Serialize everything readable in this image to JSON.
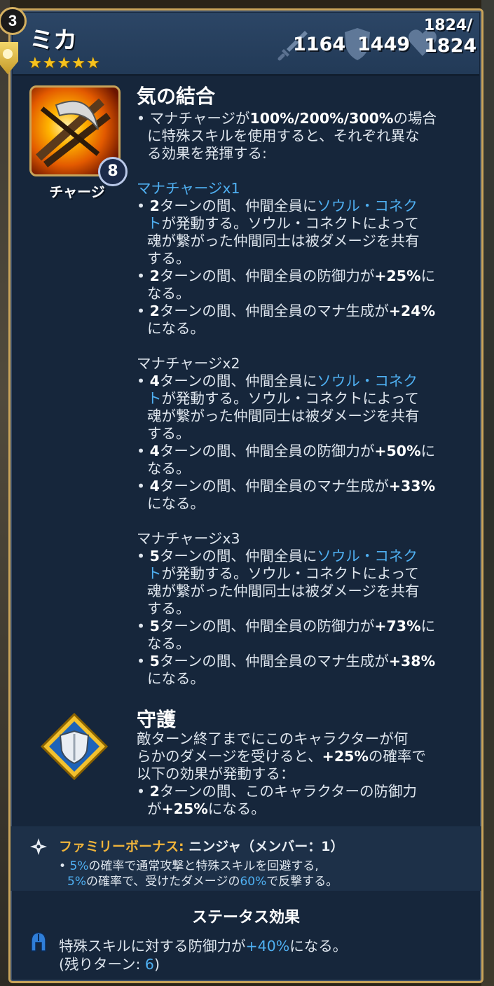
{
  "hero": {
    "level": "3",
    "name": "ミカ",
    "stars": "★★★★★",
    "attack": "1164",
    "defense": "1449",
    "hp_max": "1824/",
    "hp_current": "1824"
  },
  "skill": {
    "badge": "8",
    "label": "チャージ",
    "title": "気の結合",
    "intro_1": "• マナチャージが",
    "intro_pct": "100%/200%/300%",
    "intro_2": "の場合",
    "intro_3": "に特殊スキルを使用すると、それぞれ異な",
    "intro_4": "る効果を発揮する:",
    "tiers": [
      {
        "heading": "マナチャージx1",
        "l1_a": "• ",
        "l1_n": "2",
        "l1_b": "ターンの間、仲間全員に",
        "l1_hl": "ソウル・コネク",
        "l2_hl": "ト",
        "l2_b": "が発動する。ソウル・コネクトによって",
        "l3": "魂が繋がった仲間同士は被ダメージを共有",
        "l4": "する。",
        "l5_a": "• ",
        "l5_n": "2",
        "l5_b": "ターンの間、仲間全員の防御力が",
        "l5_p": "+25%",
        "l5_c": "に",
        "l6": "なる。",
        "l7_a": "• ",
        "l7_n": "2",
        "l7_b": "ターンの間、仲間全員のマナ生成が",
        "l7_p": "+24%",
        "l8": "になる。"
      },
      {
        "heading": "マナチャージx2",
        "l1_a": "• ",
        "l1_n": "4",
        "l1_b": "ターンの間、仲間全員に",
        "l1_hl": "ソウル・コネク",
        "l2_hl": "ト",
        "l2_b": "が発動する。ソウル・コネクトによって",
        "l3": "魂が繋がった仲間同士は被ダメージを共有",
        "l4": "する。",
        "l5_a": "• ",
        "l5_n": "4",
        "l5_b": "ターンの間、仲間全員の防御力が",
        "l5_p": "+50%",
        "l5_c": "に",
        "l6": "なる。",
        "l7_a": "• ",
        "l7_n": "4",
        "l7_b": "ターンの間、仲間全員のマナ生成が",
        "l7_p": "+33%",
        "l8": "になる。"
      },
      {
        "heading": "マナチャージx3",
        "l1_a": "• ",
        "l1_n": "5",
        "l1_b": "ターンの間、仲間全員に",
        "l1_hl": "ソウル・コネク",
        "l2_hl": "ト",
        "l2_b": "が発動する。ソウル・コネクトによって",
        "l3": "魂が繋がった仲間同士は被ダメージを共有",
        "l4": "する。",
        "l5_a": "• ",
        "l5_n": "5",
        "l5_b": "ターンの間、仲間全員の防御力が",
        "l5_p": "+73%",
        "l5_c": "に",
        "l6": "なる。",
        "l7_a": "• ",
        "l7_n": "5",
        "l7_b": "ターンの間、仲間全員のマナ生成が",
        "l7_p": "+38%",
        "l8": "になる。"
      }
    ]
  },
  "guard": {
    "title": "守護",
    "l1": "敵ターン終了までにこのキャラクターが何",
    "l2_a": "らかのダメージを受けると、",
    "l2_p": "+25%",
    "l2_b": "の確率で",
    "l3": "以下の効果が発動する：",
    "l4_a": "• ",
    "l4_n": "2",
    "l4_b": "ターンの間、このキャラクターの防御力",
    "l5_a": "が",
    "l5_p": "+25%",
    "l5_b": "になる。"
  },
  "family": {
    "title_a": "ファミリーボーナス:",
    "title_b": " ニンジャ（メンバー：1）",
    "l1_a": "• ",
    "l1_p": "5%",
    "l1_b": "の確率で通常攻撃と特殊スキルを回避する,",
    "l2_p": "5%",
    "l2_b": "の確率で、受けたダメージの",
    "l2_p2": "60%",
    "l2_c": "で反撃する。"
  },
  "status": {
    "title": "ステータス効果",
    "l1_a": "特殊スキルに対する防御力が",
    "l1_p": "+40%",
    "l1_b": "になる。",
    "l2_a": "(残りターン: ",
    "l2_n": "6",
    "l2_b": ")"
  },
  "colors": {
    "accent_blue": "#4fb0f2",
    "gold": "#f0b43a",
    "panel": "#16263b",
    "frame": "#c9a45a"
  }
}
